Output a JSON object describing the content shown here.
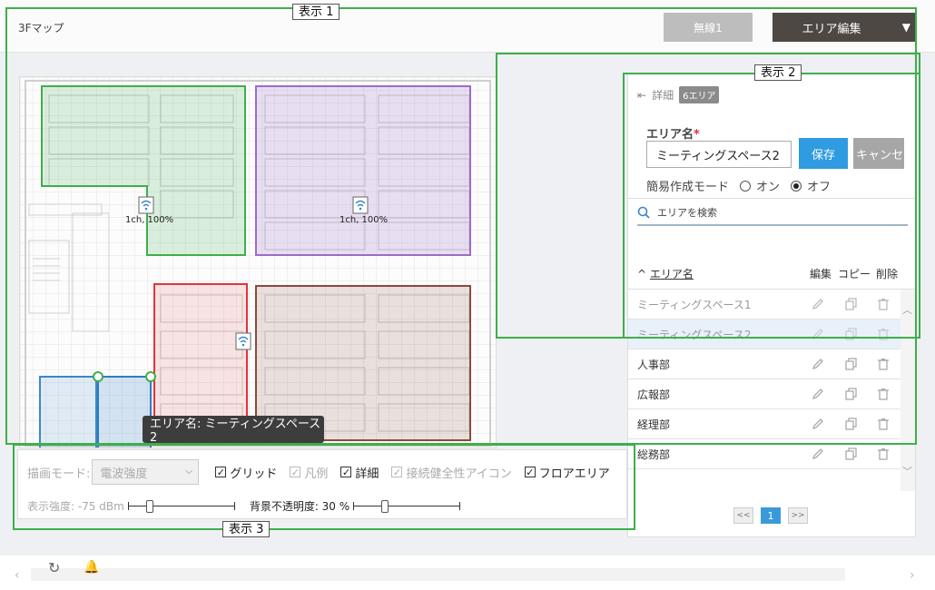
{
  "header": {
    "title": "3Fマップ",
    "wireless_label": "無線1",
    "area_edit_label": "エリア編集"
  },
  "map": {
    "ap_labels": [
      "1ch, 100%",
      "1ch, 100%"
    ],
    "tooltip": "エリア名:  ミーティングスペース2",
    "zones": [
      {
        "name": "green",
        "color": "#3fae4b"
      },
      {
        "name": "purple",
        "color": "#9b6bc9"
      },
      {
        "name": "red",
        "color": "#e0353a"
      },
      {
        "name": "brown",
        "color": "#8a4a3e"
      },
      {
        "name": "blue-1",
        "color": "#3b86c9"
      },
      {
        "name": "blue-2",
        "color": "#2e7cc4"
      }
    ]
  },
  "panel": {
    "detail_label": "詳細",
    "badge": "6エリア",
    "name_label": "エリア名",
    "required_mark": "*",
    "name_value": "ミーティングスペース2",
    "save_label": "保存",
    "cancel_label": "キャンセル",
    "mode_label": "簡易作成モード",
    "mode_on": "オン",
    "mode_off": "オフ",
    "search_placeholder": "エリアを検索",
    "col_name": "エリア名",
    "col_edit": "編集",
    "col_copy": "コピー",
    "col_delete": "削除",
    "rows": [
      "ミーティングスペース1",
      "ミーティングスペース2",
      "人事部",
      "広報部",
      "経理部",
      "総務部"
    ],
    "pager": {
      "first": "<<",
      "page": "1",
      "next": ">>"
    }
  },
  "toolbar": {
    "draw_mode_label": "描画モード:",
    "draw_mode_value": "電波強度",
    "grid": "グリッド",
    "legend": "凡例",
    "detail": "詳細",
    "health_icon": "接続健全性アイコン",
    "floor_area": "フロアエリア",
    "strength_label": "表示強度: -75 dBm",
    "opacity_label": "背景不透明度: 30 %"
  },
  "annotations": {
    "label1": "表示 1",
    "label2": "表示 2",
    "label3": "表示 3"
  },
  "colors": {
    "accent": "#2f9be0",
    "frame": "#3fae4b",
    "area_edit_bg": "#4d4844"
  }
}
